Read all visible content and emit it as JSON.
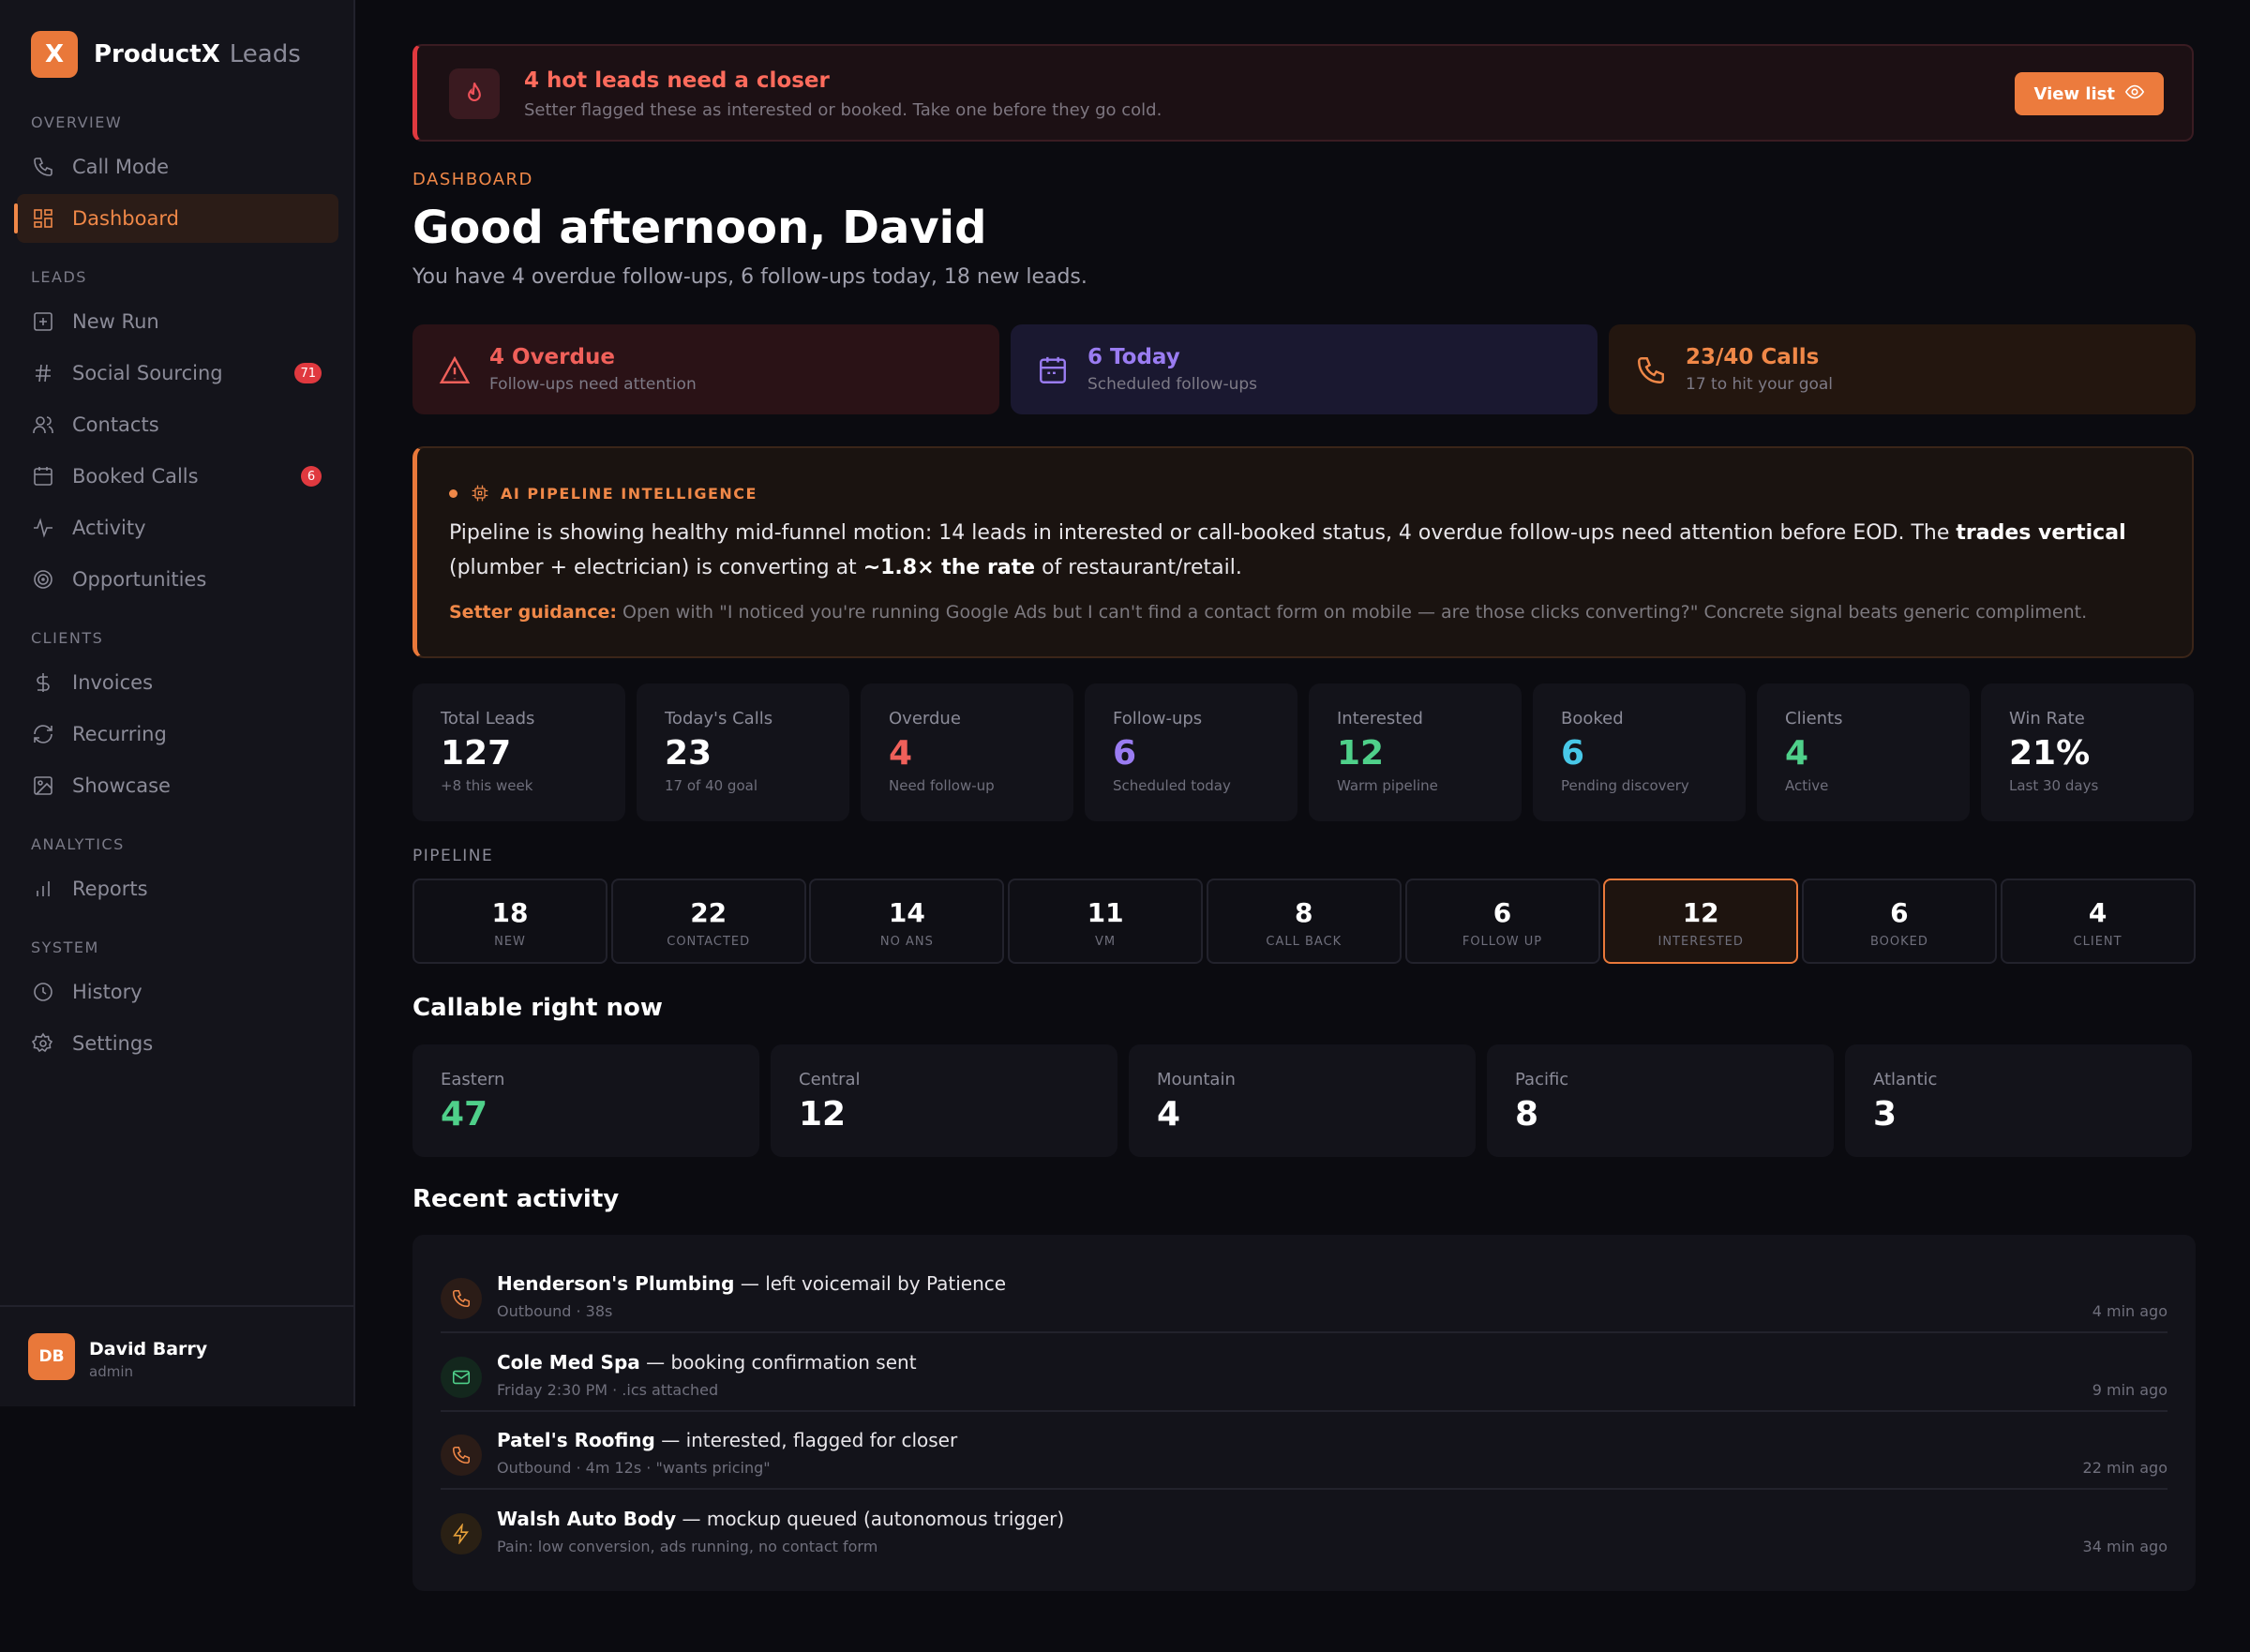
{
  "brand": {
    "initial": "X",
    "name": "ProductX",
    "sub": "Leads"
  },
  "nav": {
    "sections": [
      "OVERVIEW",
      "LEADS",
      "CLIENTS",
      "ANALYTICS",
      "SYSTEM"
    ],
    "items": [
      {
        "label": "Call Mode",
        "icon": "phone-icon"
      },
      {
        "label": "Dashboard",
        "icon": "grid-icon",
        "active": true
      },
      {
        "label": "New Run",
        "icon": "plus-square-icon"
      },
      {
        "label": "Social Sourcing",
        "icon": "hash-icon",
        "badge": "71"
      },
      {
        "label": "Contacts",
        "icon": "users-icon"
      },
      {
        "label": "Booked Calls",
        "icon": "calendar-icon",
        "badge": "6"
      },
      {
        "label": "Activity",
        "icon": "pulse-icon"
      },
      {
        "label": "Opportunities",
        "icon": "target-icon"
      },
      {
        "label": "Invoices",
        "icon": "dollar-icon"
      },
      {
        "label": "Recurring",
        "icon": "refresh-icon"
      },
      {
        "label": "Showcase",
        "icon": "image-icon"
      },
      {
        "label": "Reports",
        "icon": "bar-chart-icon"
      },
      {
        "label": "History",
        "icon": "clock-icon"
      },
      {
        "label": "Settings",
        "icon": "gear-icon"
      }
    ]
  },
  "user": {
    "initials": "DB",
    "name": "David Barry",
    "role": "admin"
  },
  "alert": {
    "title": "4 hot leads need a closer",
    "subtitle": "Setter flagged these as interested or booked. Take one before they go cold.",
    "button": "View list"
  },
  "header": {
    "crumb": "DASHBOARD",
    "greeting": "Good afternoon, David",
    "summary": "You have 4 overdue follow-ups, 6 follow-ups today, 18 new leads."
  },
  "kpis": [
    {
      "title": "4 Overdue",
      "sub": "Follow-ups need attention",
      "color": "#f0605a",
      "bg": "#2a1216"
    },
    {
      "title": "6 Today",
      "sub": "Scheduled follow-ups",
      "color": "#9a7cf2",
      "bg": "#1a1830"
    },
    {
      "title": "23/40 Calls",
      "sub": "17 to hit your goal",
      "color": "#f08848",
      "bg": "#23160f"
    }
  ],
  "ai": {
    "heading": "AI PIPELINE INTELLIGENCE",
    "text_1": "Pipeline is showing healthy mid-funnel motion: 14 leads in interested or call-booked status, 4 overdue follow-ups need attention before EOD. The ",
    "bold_1": "trades vertical",
    "text_2": " (plumber + electrician) is converting at ",
    "bold_2": "~1.8× the rate",
    "text_3": " of restaurant/retail.",
    "guide_label": "Setter guidance:",
    "guide_text": " Open with \"I noticed you're running Google Ads but I can't find a contact form on mobile — are those clicks converting?\" Concrete signal beats generic compliment."
  },
  "stats": [
    {
      "label": "Total Leads",
      "value": "127",
      "sub": "+8 this week",
      "color": "#ffffff"
    },
    {
      "label": "Today's Calls",
      "value": "23",
      "sub": "17 of 40 goal",
      "color": "#ffffff"
    },
    {
      "label": "Overdue",
      "value": "4",
      "sub": "Need follow-up",
      "color": "#f0605a"
    },
    {
      "label": "Follow-ups",
      "value": "6",
      "sub": "Scheduled today",
      "color": "#9a7cf2"
    },
    {
      "label": "Interested",
      "value": "12",
      "sub": "Warm pipeline",
      "color": "#4fd08a"
    },
    {
      "label": "Booked",
      "value": "6",
      "sub": "Pending discovery",
      "color": "#48c8e8"
    },
    {
      "label": "Clients",
      "value": "4",
      "sub": "Active",
      "color": "#4fd08a"
    },
    {
      "label": "Win Rate",
      "value": "21%",
      "sub": "Last 30 days",
      "color": "#ffffff"
    }
  ],
  "pipeline": {
    "title": "PIPELINE",
    "stages": [
      {
        "count": "18",
        "label": "NEW"
      },
      {
        "count": "22",
        "label": "CONTACTED"
      },
      {
        "count": "14",
        "label": "NO ANS"
      },
      {
        "count": "11",
        "label": "VM"
      },
      {
        "count": "8",
        "label": "CALL BACK"
      },
      {
        "count": "6",
        "label": "FOLLOW UP"
      },
      {
        "count": "12",
        "label": "INTERESTED",
        "active": true
      },
      {
        "count": "6",
        "label": "BOOKED"
      },
      {
        "count": "4",
        "label": "CLIENT"
      }
    ]
  },
  "callable": {
    "title": "Callable right now",
    "zones": [
      {
        "label": "Eastern",
        "value": "47",
        "color": "#4fd08a"
      },
      {
        "label": "Central",
        "value": "12",
        "color": "#ffffff"
      },
      {
        "label": "Mountain",
        "value": "4",
        "color": "#ffffff"
      },
      {
        "label": "Pacific",
        "value": "8",
        "color": "#ffffff"
      },
      {
        "label": "Atlantic",
        "value": "3",
        "color": "#ffffff"
      }
    ]
  },
  "activity": {
    "title": "Recent activity",
    "items": [
      {
        "name": "Henderson's Plumbing",
        "action": " — left voicemail by Patience",
        "sub": "Outbound · 38s",
        "time": "4 min ago",
        "icon": "phone-icon",
        "color": "#f08848",
        "bg": "#2b1c17"
      },
      {
        "name": "Cole Med Spa",
        "action": " — booking confirmation sent",
        "sub": "Friday 2:30 PM · .ics attached",
        "time": "9 min ago",
        "icon": "mail-icon",
        "color": "#4fd08a",
        "bg": "#13271d"
      },
      {
        "name": "Patel's Roofing",
        "action": " — interested, flagged for closer",
        "sub": "Outbound · 4m 12s · \"wants pricing\"",
        "time": "22 min ago",
        "icon": "phone-icon",
        "color": "#f08848",
        "bg": "#2b1c17"
      },
      {
        "name": "Walsh Auto Body",
        "action": " — mockup queued (autonomous trigger)",
        "sub": "Pain: low conversion, ads running, no contact form",
        "time": "34 min ago",
        "icon": "bolt-icon",
        "color": "#e9a23a",
        "bg": "#2a2014"
      }
    ]
  }
}
